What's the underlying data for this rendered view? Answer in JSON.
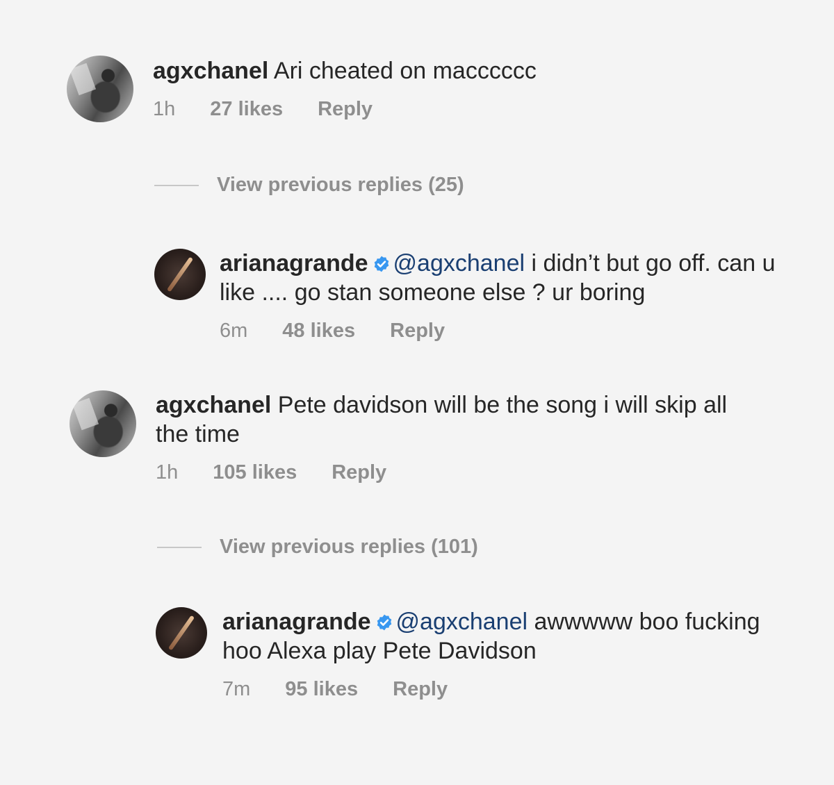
{
  "comments": [
    {
      "username": "agxchanel",
      "text": "Ari cheated on macccccc",
      "time": "1h",
      "likes": "27 likes",
      "reply": "Reply"
    },
    {
      "username": "agxchanel",
      "text": "Pete davidson will be the song i will skip all the time",
      "time": "1h",
      "likes": "105 likes",
      "reply": "Reply"
    }
  ],
  "view_replies": [
    {
      "label": "View previous replies (25)"
    },
    {
      "label": "View previous replies (101)"
    }
  ],
  "replies": [
    {
      "username": "arianagrande",
      "mention": "@agxchanel",
      "text": "i didn’t but go off. can u like .... go stan someone else ? ur boring",
      "time": "6m",
      "likes": "48 likes",
      "reply": "Reply"
    },
    {
      "username": "arianagrande",
      "mention": "@agxchanel",
      "text": "awwwww boo fucking hoo Alexa play Pete Davidson",
      "time": "7m",
      "likes": "95 likes",
      "reply": "Reply"
    }
  ],
  "colors": {
    "verified_badge": "#3897f0",
    "mention": "#1a3f72",
    "meta": "#8e8e8e"
  }
}
